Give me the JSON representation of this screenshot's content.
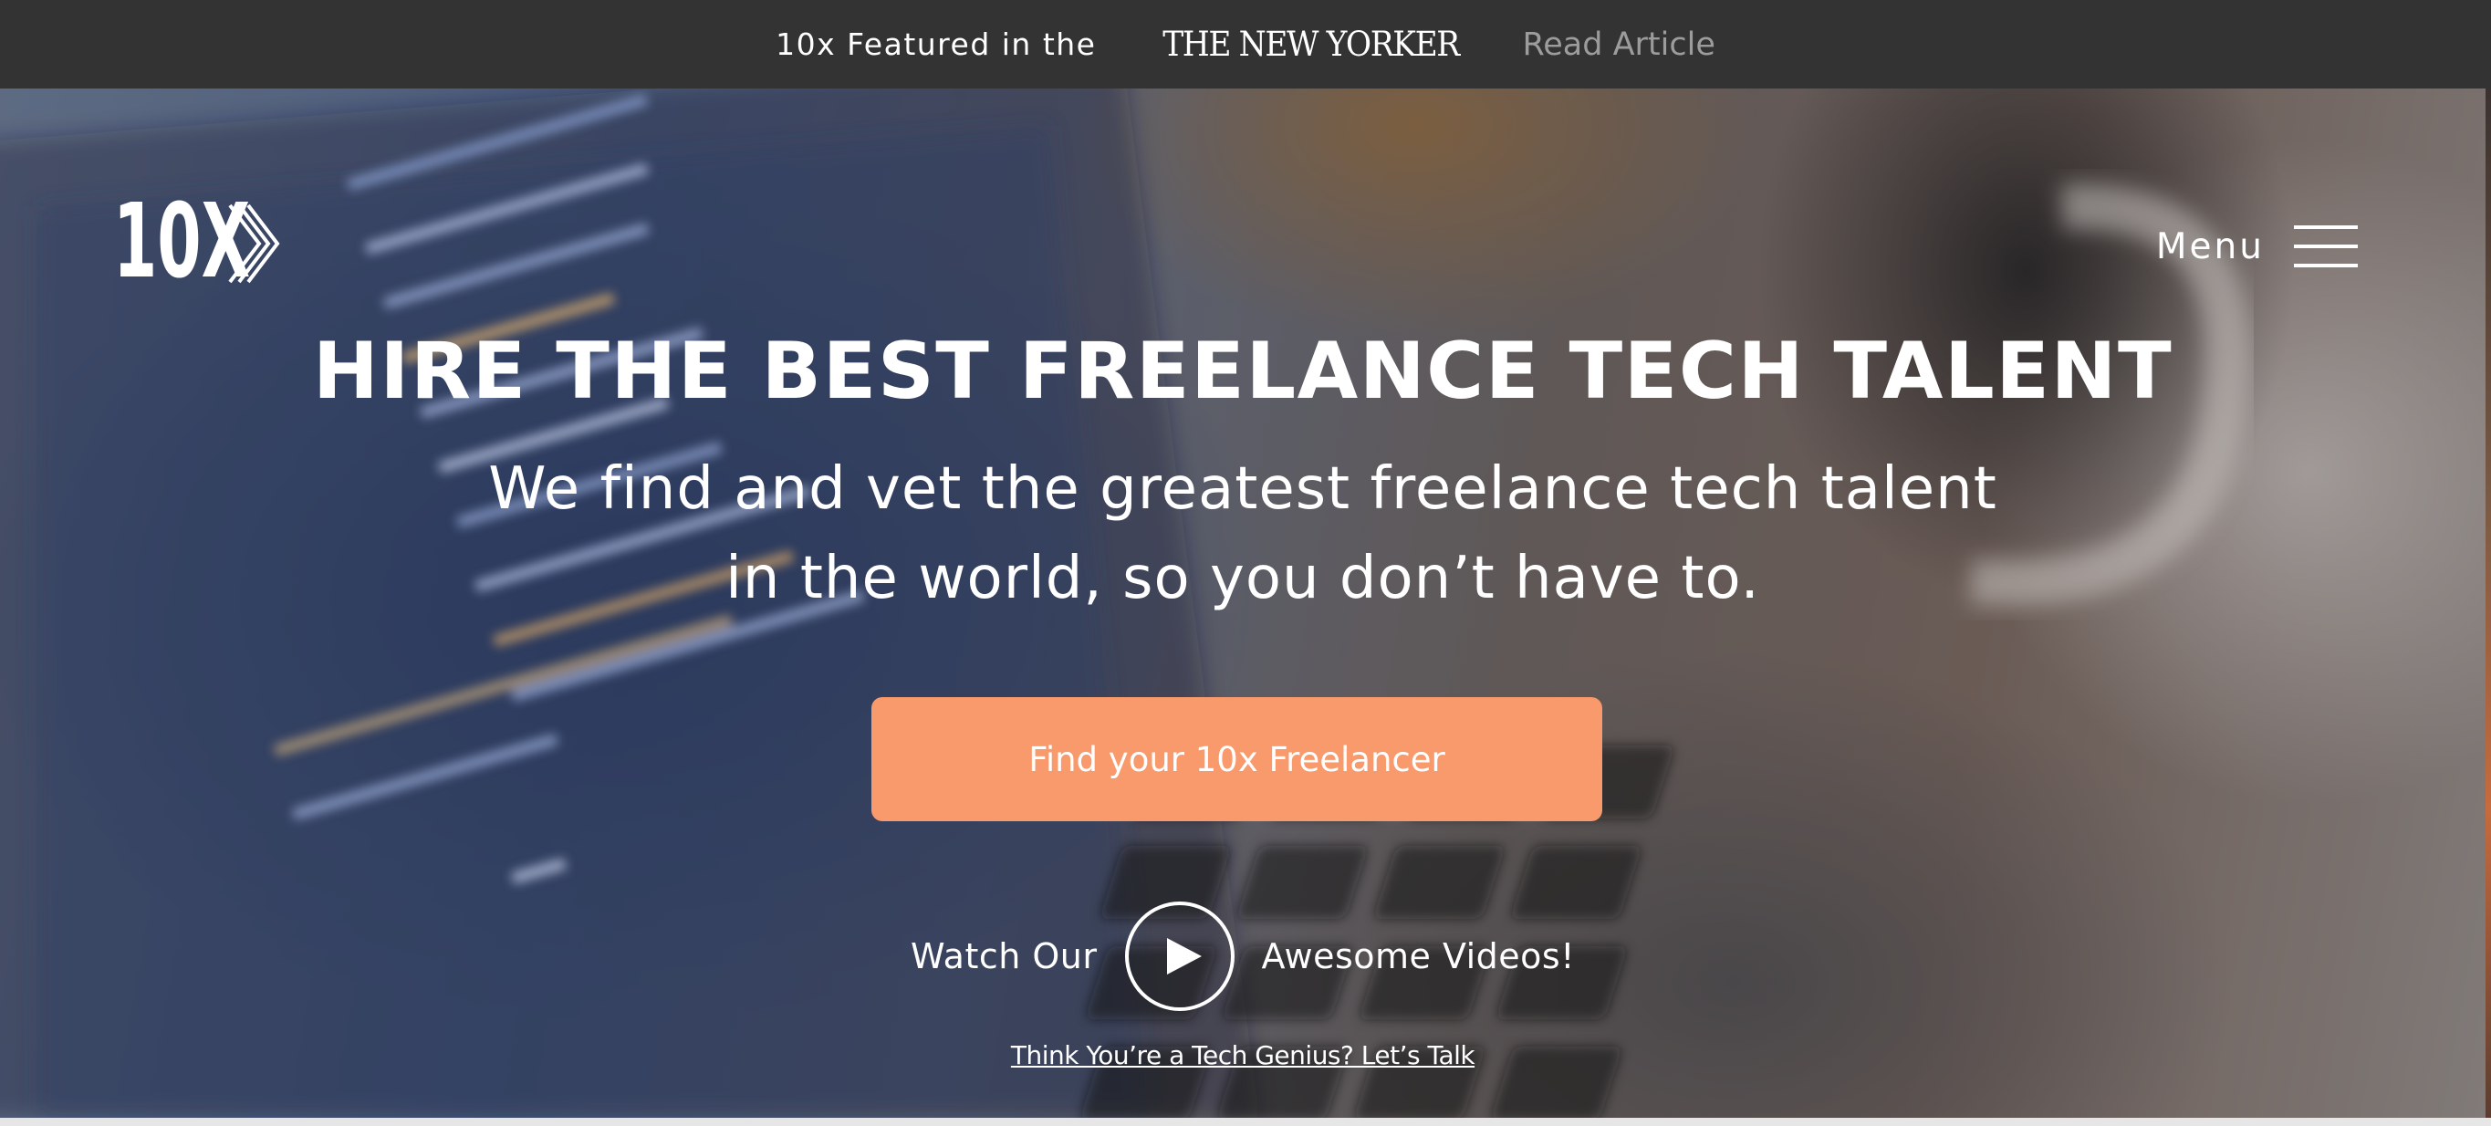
{
  "announcement": {
    "featured_text": "10x Featured in the",
    "publication": "THE NEW YORKER",
    "read_link": "Read Article"
  },
  "header": {
    "logo_text": "10X",
    "menu_label": "Menu"
  },
  "hero": {
    "headline": "HIRE THE BEST FREELANCE TECH TALENT",
    "subline_1": "We find and vet the greatest freelance tech talent",
    "subline_2": "in the world, so you don’t have to.",
    "cta_label": "Find your 10x Freelancer",
    "videos_prefix": "Watch Our",
    "videos_suffix": "Awesome Videos!",
    "talk_link": "Think You’re a Tech Genius? Let’s Talk"
  },
  "colors": {
    "topbar": "#333333",
    "cta": "#f89a6b",
    "read_link": "#9c9c9c"
  },
  "icons": [
    "logo-10x",
    "hamburger-menu-icon",
    "play-icon"
  ]
}
